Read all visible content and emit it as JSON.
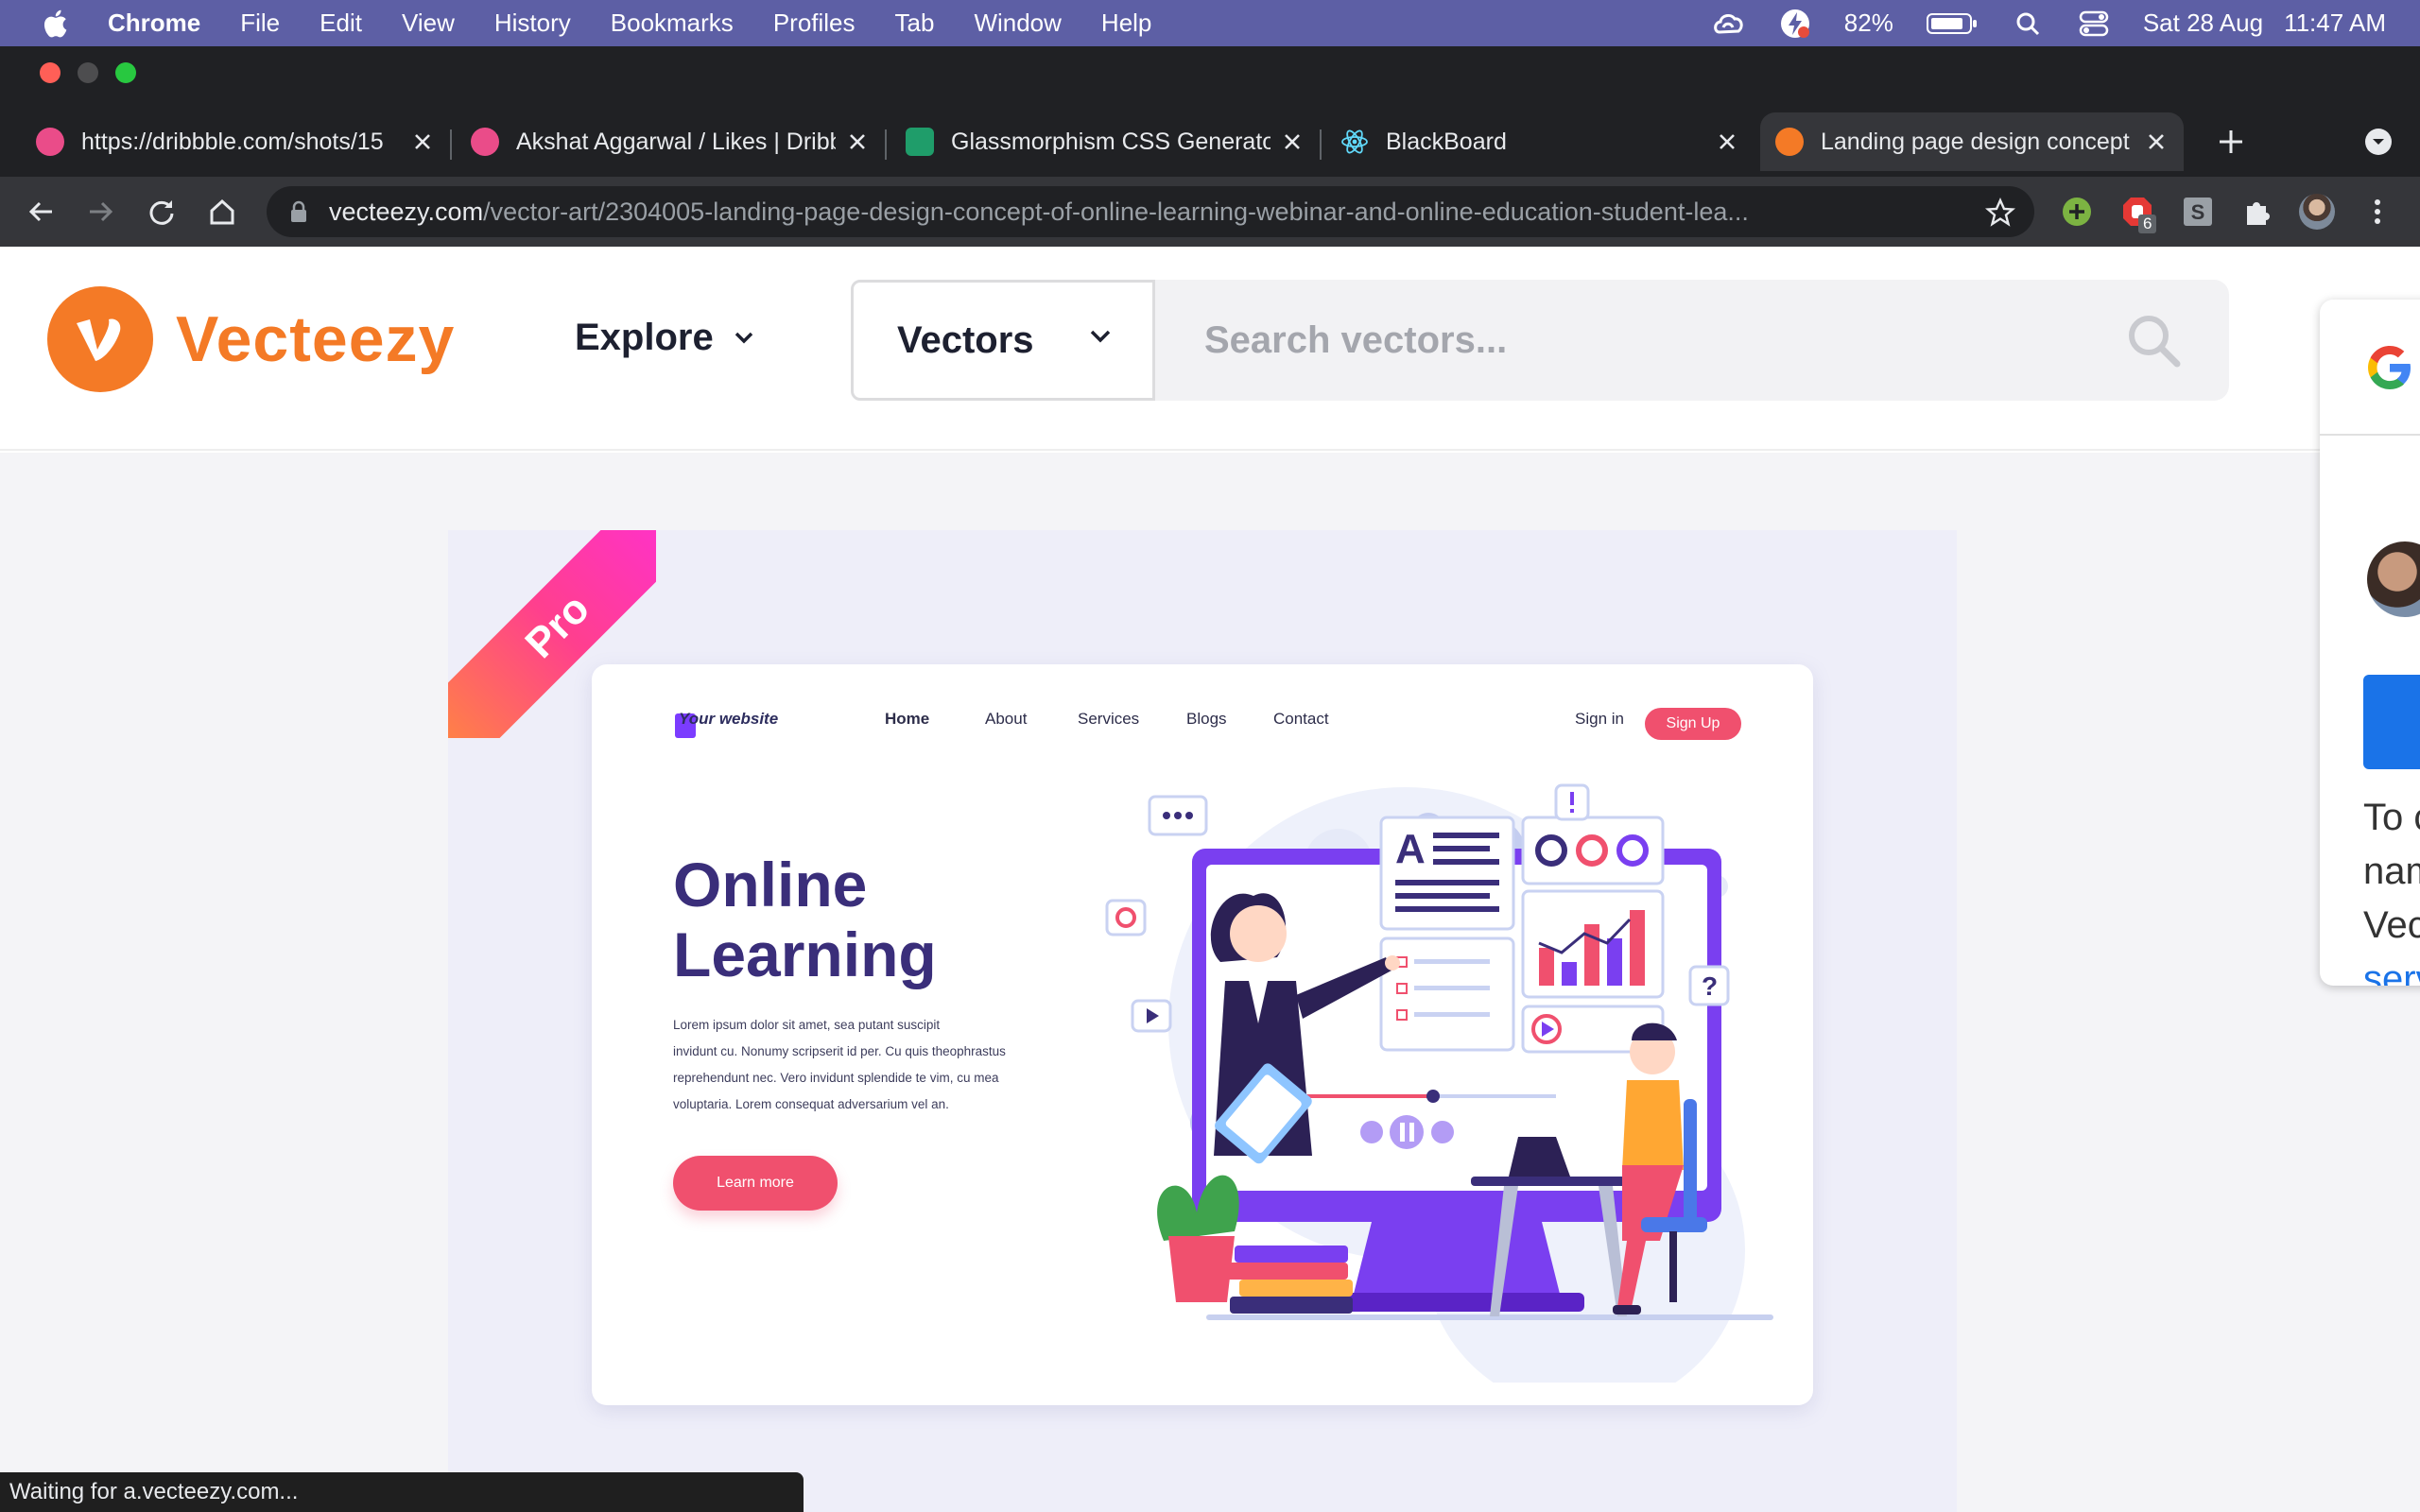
{
  "menubar": {
    "app_name": "Chrome",
    "items": [
      "File",
      "Edit",
      "View",
      "History",
      "Bookmarks",
      "Profiles",
      "Tab",
      "Window",
      "Help"
    ],
    "battery": "82%",
    "date": "Sat 28 Aug",
    "time": "11:47 AM"
  },
  "tabs": [
    {
      "title": "https://dribbble.com/shots/15",
      "icon": "dribbble-icon"
    },
    {
      "title": "Akshat Aggarwal / Likes | Dribbble",
      "icon": "dribbble-icon"
    },
    {
      "title": "Glassmorphism CSS Generator",
      "icon": "glassmorphism-icon"
    },
    {
      "title": "BlackBoard",
      "icon": "react-icon"
    },
    {
      "title": "Landing page design concept",
      "icon": "vecteezy-icon"
    }
  ],
  "toolbar": {
    "url_host": "vecteezy.com",
    "url_path": "/vector-art/2304005-landing-page-design-concept-of-online-learning-webinar-and-online-education-student-lea...",
    "extension_badge": "6"
  },
  "site": {
    "logo_text": "Vecteezy",
    "explore_label": "Explore",
    "search_type": "Vectors",
    "search_placeholder": "Search vectors..."
  },
  "preview": {
    "badge": "Pro",
    "brand": "Your website",
    "nav": [
      "Home",
      "About",
      "Services",
      "Blogs",
      "Contact"
    ],
    "sign_in": "Sign in",
    "sign_up": "Sign Up",
    "headline_1": "Online",
    "headline_2": "Learning",
    "body_lines": [
      "Lorem ipsum dolor sit amet, sea putant suscipit",
      "invidunt cu. Nonumy scripserit id per. Cu quis theophrastus",
      "reprehendunt nec. Vero invidunt splendide te vim, cu mea",
      "voluptaria. Lorem consequat adversarium vel an."
    ],
    "cta": "Learn more"
  },
  "google_panel": {
    "lines": [
      "To c",
      "nam",
      "Vec"
    ],
    "link": "serv"
  },
  "status": "Waiting for a.vecteezy.com...",
  "colors": {
    "menubar": "#5d5fa5",
    "brand_orange": "#f47a26",
    "cta_pink": "#f0506e",
    "headline_purple": "#3a2e7a"
  }
}
